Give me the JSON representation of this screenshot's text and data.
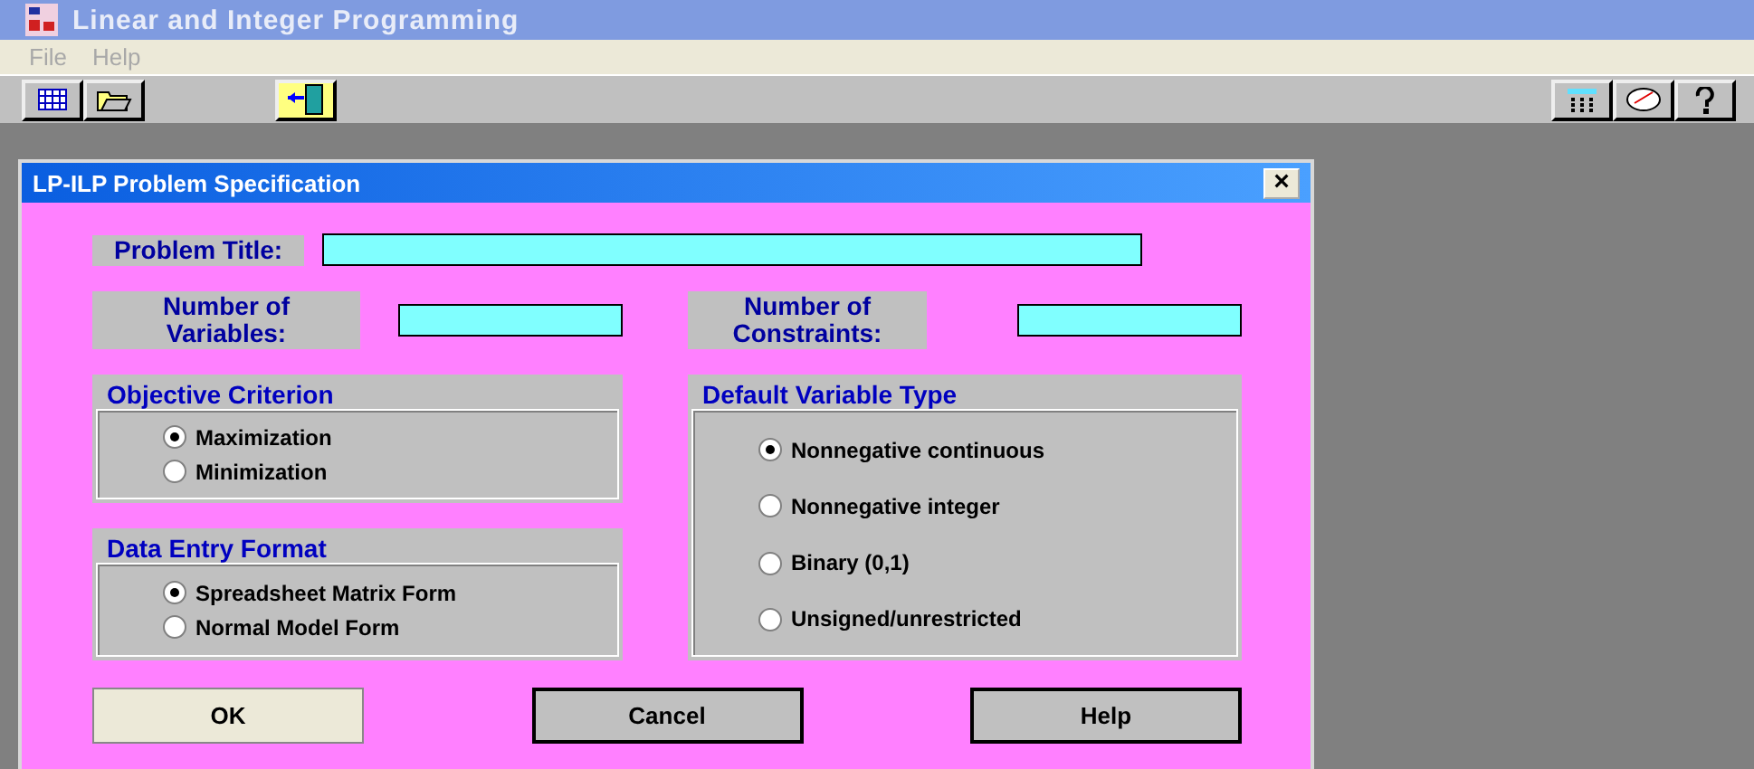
{
  "window": {
    "title": "Linear and Integer Programming"
  },
  "menu": [
    "File",
    "Help"
  ],
  "dialog": {
    "title": "LP-ILP Problem Specification",
    "close": "×",
    "title_field": {
      "label": "Problem Title:"
    },
    "count_fields": [
      {
        "label": "Number of Variables:"
      },
      {
        "label": "Number of Constraints:"
      }
    ],
    "groups": [
      {
        "title": "Objective Criterion",
        "options": [
          {
            "label": "Maximization",
            "selected": true
          },
          {
            "label": "Minimization",
            "selected": false
          }
        ]
      },
      {
        "title": "Data Entry Format",
        "options": [
          {
            "label": "Spreadsheet Matrix Form",
            "selected": true
          },
          {
            "label": "Normal Model Form",
            "selected": false
          }
        ]
      },
      {
        "title": "Default Variable Type",
        "options": [
          {
            "label": "Nonnegative continuous",
            "selected": true
          },
          {
            "label": "Nonnegative integer",
            "selected": false
          },
          {
            "label": "Binary (0,1)",
            "selected": false
          },
          {
            "label": "Unsigned/unrestricted",
            "selected": false
          }
        ]
      }
    ],
    "buttons": [
      {
        "label": "OK",
        "default": true
      },
      {
        "label": "Cancel",
        "default": false
      },
      {
        "label": "Help",
        "default": false
      }
    ]
  }
}
